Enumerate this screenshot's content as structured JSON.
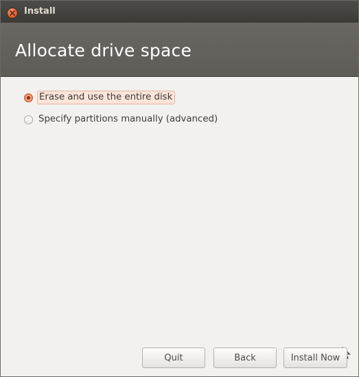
{
  "window": {
    "title": "Install"
  },
  "header": {
    "title": "Allocate drive space"
  },
  "options": [
    {
      "label": "Erase and use the entire disk",
      "selected": true
    },
    {
      "label": "Specify partitions manually (advanced)",
      "selected": false
    }
  ],
  "buttons": {
    "quit": "Quit",
    "back": "Back",
    "install_now": "Install Now"
  },
  "colors": {
    "titlebar": "#3c3b37",
    "header": "#65625d",
    "accent": "#e36b3d",
    "background": "#f2f1f0"
  },
  "icons": {
    "close": "close-icon",
    "pointer": "mouse-pointer-icon"
  }
}
